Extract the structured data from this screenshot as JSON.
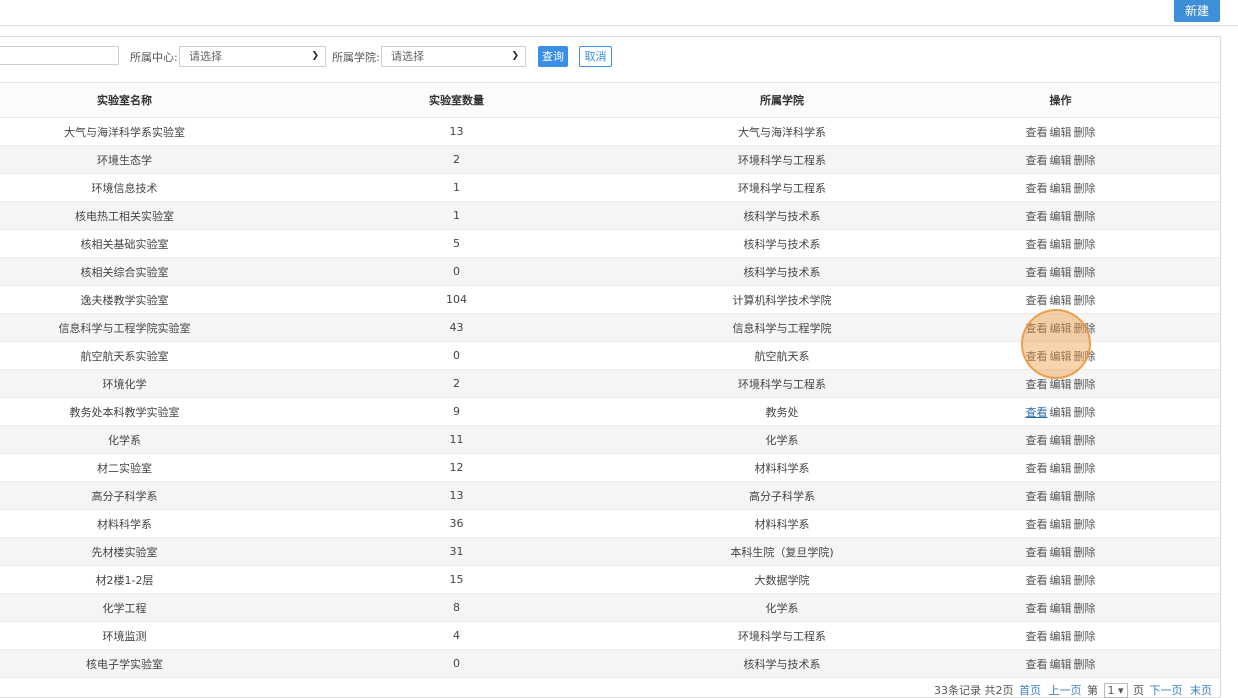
{
  "toolbar": {
    "new_label": "新建"
  },
  "filters": {
    "center_label": "所属中心:",
    "center_value": "请选择",
    "college_label": "所属学院:",
    "college_value": "请选择",
    "query_label": "查询",
    "cancel_label": "取消"
  },
  "table": {
    "headers": [
      "实验室名称",
      "实验室数量",
      "所属学院",
      "操作"
    ],
    "actions": [
      "查看",
      "编辑",
      "删除"
    ],
    "rows": [
      [
        "大气与海洋科学系实验室",
        "13",
        "大气与海洋科学系"
      ],
      [
        "环境生态学",
        "2",
        "环境科学与工程系"
      ],
      [
        "环境信息技术",
        "1",
        "环境科学与工程系"
      ],
      [
        "核电热工相关实验室",
        "1",
        "核科学与技术系"
      ],
      [
        "核相关基础实验室",
        "5",
        "核科学与技术系"
      ],
      [
        "核相关综合实验室",
        "0",
        "核科学与技术系"
      ],
      [
        "逸夫楼教学实验室",
        "104",
        "计算机科学技术学院"
      ],
      [
        "信息科学与工程学院实验室",
        "43",
        "信息科学与工程学院"
      ],
      [
        "航空航天系实验室",
        "0",
        "航空航天系"
      ],
      [
        "环境化学",
        "2",
        "环境科学与工程系"
      ],
      [
        "教务处本科教学实验室",
        "9",
        "教务处"
      ],
      [
        "化学系",
        "11",
        "化学系"
      ],
      [
        "材二实验室",
        "12",
        "材料科学系"
      ],
      [
        "高分子科学系",
        "13",
        "高分子科学系"
      ],
      [
        "材料科学系",
        "36",
        "材料科学系"
      ],
      [
        "先材楼实验室",
        "31",
        "本科生院（复旦学院)"
      ],
      [
        "材2楼1-2层",
        "15",
        "大数据学院"
      ],
      [
        "化学工程",
        "8",
        "化学系"
      ],
      [
        "环境监测",
        "4",
        "环境科学与工程系"
      ],
      [
        "核电子学实验室",
        "0",
        "核科学与技术系"
      ]
    ]
  },
  "pager": {
    "records": "33条记录",
    "pages": "共2页",
    "first": "首页",
    "prev": "上一页",
    "page_prefix": "第",
    "page_value": "1",
    "page_suffix": "页",
    "next": "下一页",
    "last": "末页"
  }
}
